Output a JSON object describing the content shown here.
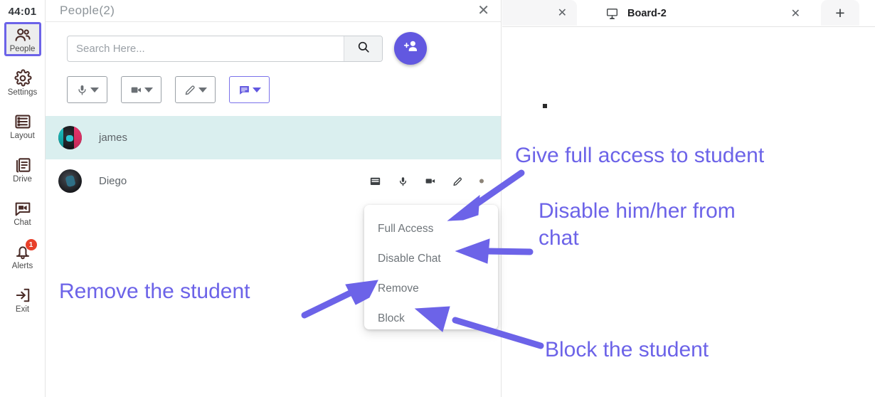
{
  "rail": {
    "timer": "44:01",
    "items": [
      {
        "label": "People",
        "icon": "people-icon",
        "active": true,
        "badge": null
      },
      {
        "label": "Settings",
        "icon": "gear-icon",
        "active": false,
        "badge": null
      },
      {
        "label": "Layout",
        "icon": "layout-icon",
        "active": false,
        "badge": null
      },
      {
        "label": "Drive",
        "icon": "drive-icon",
        "active": false,
        "badge": null
      },
      {
        "label": "Chat",
        "icon": "chat-icon",
        "active": false,
        "badge": null
      },
      {
        "label": "Alerts",
        "icon": "bell-icon",
        "active": false,
        "badge": "1"
      },
      {
        "label": "Exit",
        "icon": "exit-icon",
        "active": false,
        "badge": null
      }
    ]
  },
  "panel": {
    "title": "People(2)",
    "close_label": "✕",
    "search": {
      "placeholder": "Search Here...",
      "value": "",
      "button_icon": "search-icon"
    },
    "add_user_icon": "add-person-icon",
    "tools": [
      {
        "icon": "microphone-icon",
        "selected": false
      },
      {
        "icon": "video-camera-icon",
        "selected": false
      },
      {
        "icon": "pencil-icon",
        "selected": false
      },
      {
        "icon": "chat-bubble-icon",
        "selected": true
      }
    ],
    "participants": [
      {
        "name": "james",
        "highlighted": true,
        "avatar": "video-thumbnail-james"
      },
      {
        "name": "Diego",
        "highlighted": false,
        "avatar": "video-thumbnail-diego"
      }
    ],
    "row_icons": [
      "whiteboard-icon",
      "microphone-icon",
      "video-camera-icon",
      "pencil-icon",
      "more-dot-icon"
    ]
  },
  "context_menu": {
    "items": [
      {
        "label": "Full Access"
      },
      {
        "label": "Disable Chat"
      },
      {
        "label": "Remove"
      },
      {
        "label": "Block"
      }
    ]
  },
  "right_panel": {
    "tabs": [
      {
        "label": "",
        "icon": null,
        "close_label": "✕",
        "partial": true
      },
      {
        "label": "Board-2",
        "icon": "board-icon",
        "close_label": "✕",
        "partial": false
      }
    ],
    "new_tab_label": "+",
    "canvas_mark": "."
  },
  "annotations": {
    "accent_color": "#6c63e8",
    "items": [
      {
        "id": "give-full-access",
        "text": "Give full access to student"
      },
      {
        "id": "disable-chat",
        "text": "Disable him/her from\nchat"
      },
      {
        "id": "remove-student",
        "text": "Remove the student"
      },
      {
        "id": "block-student",
        "text": "Block the student"
      }
    ]
  },
  "colors": {
    "accent": "#6c63e8",
    "primary": "#6258e0",
    "row_highlight": "#daefef",
    "badge": "#e8402a",
    "icon_dark": "#4a2c28"
  }
}
